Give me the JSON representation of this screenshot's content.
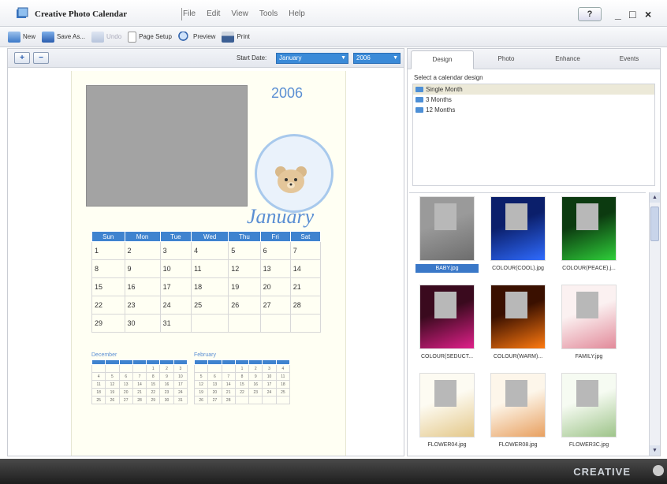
{
  "app": {
    "title": "Creative Photo Calendar",
    "menu": [
      "File",
      "Edit",
      "View",
      "Tools",
      "Help"
    ],
    "help_label": "?",
    "window_controls": {
      "minimize": "_",
      "restore": "□",
      "close": "×"
    }
  },
  "toolbar": {
    "new": "New",
    "save_as": "Save As...",
    "undo": "Undo",
    "page_setup": "Page Setup",
    "preview": "Preview",
    "print": "Print"
  },
  "editor": {
    "zoom_in_icon": "zoom-in-icon",
    "zoom_out_icon": "zoom-out-icon",
    "start_date_label": "Start Date:",
    "start_month": "January",
    "start_year": "2006"
  },
  "calendar": {
    "year": "2006",
    "month": "January",
    "weekdays": [
      "Sun",
      "Mon",
      "Tue",
      "Wed",
      "Thu",
      "Fri",
      "Sat"
    ],
    "weeks": [
      [
        "1",
        "2",
        "3",
        "4",
        "5",
        "6",
        "7"
      ],
      [
        "8",
        "9",
        "10",
        "11",
        "12",
        "13",
        "14"
      ],
      [
        "15",
        "16",
        "17",
        "18",
        "19",
        "20",
        "21"
      ],
      [
        "22",
        "23",
        "24",
        "25",
        "26",
        "27",
        "28"
      ],
      [
        "29",
        "30",
        "31",
        "",
        "",
        "",
        ""
      ]
    ],
    "prev_month": {
      "name": "December",
      "weeks": [
        [
          "",
          "",
          "",
          "",
          "1",
          "2",
          "3"
        ],
        [
          "4",
          "5",
          "6",
          "7",
          "8",
          "9",
          "10"
        ],
        [
          "11",
          "12",
          "13",
          "14",
          "15",
          "16",
          "17"
        ],
        [
          "18",
          "19",
          "20",
          "21",
          "22",
          "23",
          "24"
        ],
        [
          "25",
          "26",
          "27",
          "28",
          "29",
          "30",
          "31"
        ]
      ]
    },
    "next_month": {
      "name": "February",
      "weeks": [
        [
          "",
          "",
          "",
          "1",
          "2",
          "3",
          "4"
        ],
        [
          "5",
          "6",
          "7",
          "8",
          "9",
          "10",
          "11"
        ],
        [
          "12",
          "13",
          "14",
          "15",
          "16",
          "17",
          "18"
        ],
        [
          "19",
          "20",
          "21",
          "22",
          "23",
          "24",
          "25"
        ],
        [
          "26",
          "27",
          "28",
          "",
          "",
          "",
          ""
        ]
      ]
    }
  },
  "panel": {
    "tabs": [
      "Design",
      "Photo",
      "Enhance",
      "Events"
    ],
    "active_tab": "Design",
    "select_label": "Select a calendar design",
    "designs": [
      "Single Month",
      "3 Months",
      "12 Months"
    ],
    "selected_design": "Single Month",
    "thumbnails": [
      {
        "label": "BABY.jpg",
        "bg": "#9a9a9a",
        "accent": "#6d6d6d"
      },
      {
        "label": "COLOUR(COOL).jpg",
        "bg": "#0b1f6b",
        "accent": "#2f6bff"
      },
      {
        "label": "COLOUR(PEACE).j...",
        "bg": "#0c3a10",
        "accent": "#2fcf3a"
      },
      {
        "label": "COLOUR(SEDUCT...",
        "bg": "#3a0a1e",
        "accent": "#e0208a"
      },
      {
        "label": "COLOUR(WARM)...",
        "bg": "#3a1000",
        "accent": "#ff7a10"
      },
      {
        "label": "FAMILY.jpg",
        "bg": "#fbf1f1",
        "accent": "#e28a9a"
      },
      {
        "label": "FLOWER04.jpg",
        "bg": "#fdfbf2",
        "accent": "#e4c88a"
      },
      {
        "label": "FLOWER08.jpg",
        "bg": "#fdf6ea",
        "accent": "#e8a060"
      },
      {
        "label": "FLOWER3C.jpg",
        "bg": "#f6fbf2",
        "accent": "#9ec48a"
      }
    ],
    "selected_thumbnail": "BABY.jpg"
  },
  "status": {
    "brand": "CREATIVE"
  },
  "colors": {
    "accent": "#3f83cf",
    "month_text": "#5b8fd3",
    "selection": "#3a78c8"
  }
}
